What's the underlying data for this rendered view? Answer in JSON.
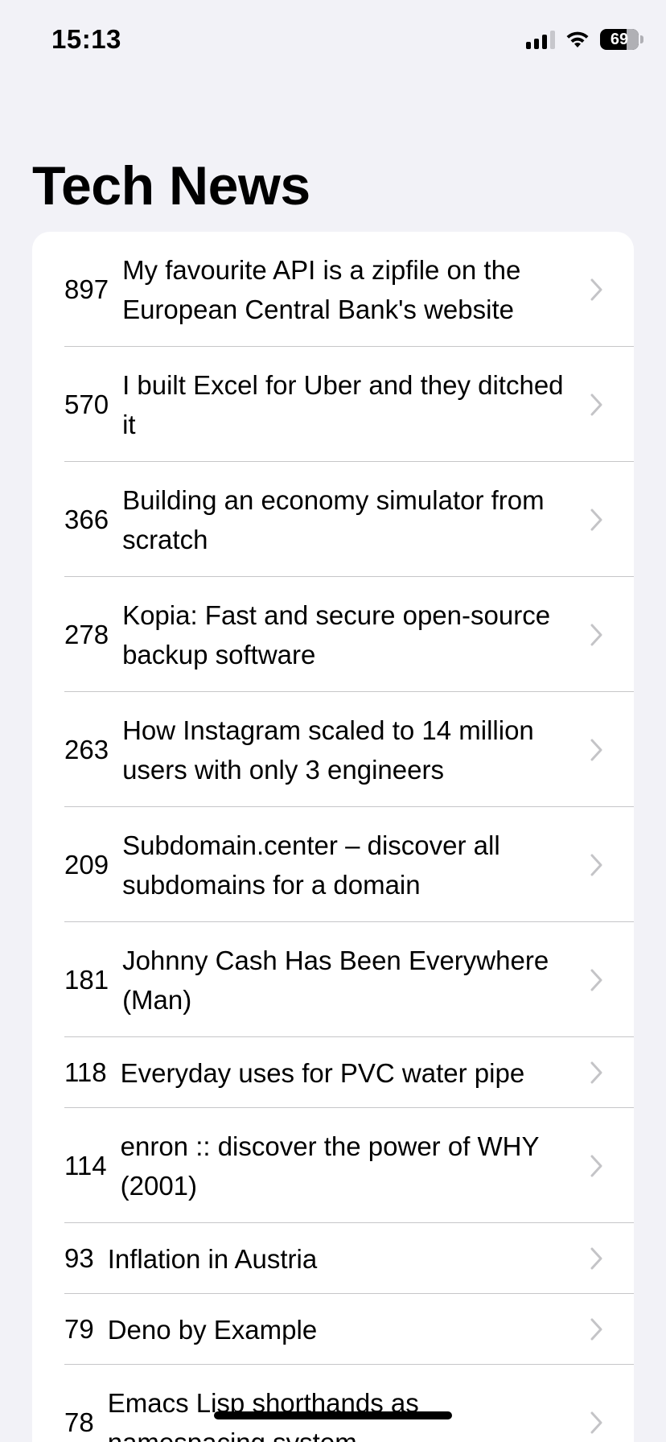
{
  "status_bar": {
    "time": "15:13",
    "battery_percent": "69",
    "battery_level": 0.69,
    "signal_icon": "cellular-signal-icon",
    "wifi_icon": "wifi-icon"
  },
  "header": {
    "title": "Tech News"
  },
  "stories": [
    {
      "score": "897",
      "title": "My favourite API is a zipfile on the European Central Bank's website",
      "size": "tall"
    },
    {
      "score": "570",
      "title": "I built Excel for Uber and they ditched it",
      "size": "tall"
    },
    {
      "score": "366",
      "title": "Building an economy simulator from scratch",
      "size": "tall"
    },
    {
      "score": "278",
      "title": "Kopia: Fast and secure open-source backup software",
      "size": "tall"
    },
    {
      "score": "263",
      "title": "How Instagram scaled to 14 million users with only 3 engineers",
      "size": "tall"
    },
    {
      "score": "209",
      "title": "Subdomain.center – discover all subdomains for a domain",
      "size": "tall"
    },
    {
      "score": "181",
      "title": "Johnny Cash Has Been Everywhere (Man)",
      "size": "tall"
    },
    {
      "score": "118",
      "title": "Everyday uses for PVC water pipe",
      "size": "short"
    },
    {
      "score": "114",
      "title": "enron :: discover the power of WHY (2001)",
      "size": "tall"
    },
    {
      "score": "93",
      "title": "Inflation in Austria",
      "size": "short"
    },
    {
      "score": "79",
      "title": "Deno by Example",
      "size": "short"
    },
    {
      "score": "78",
      "title": "Emacs Lisp shorthands as namespacing system",
      "size": "tall"
    }
  ],
  "colors": {
    "background": "#f2f2f7",
    "card": "#ffffff",
    "separator": "#c6c6c8",
    "chevron": "#c4c4c7"
  }
}
